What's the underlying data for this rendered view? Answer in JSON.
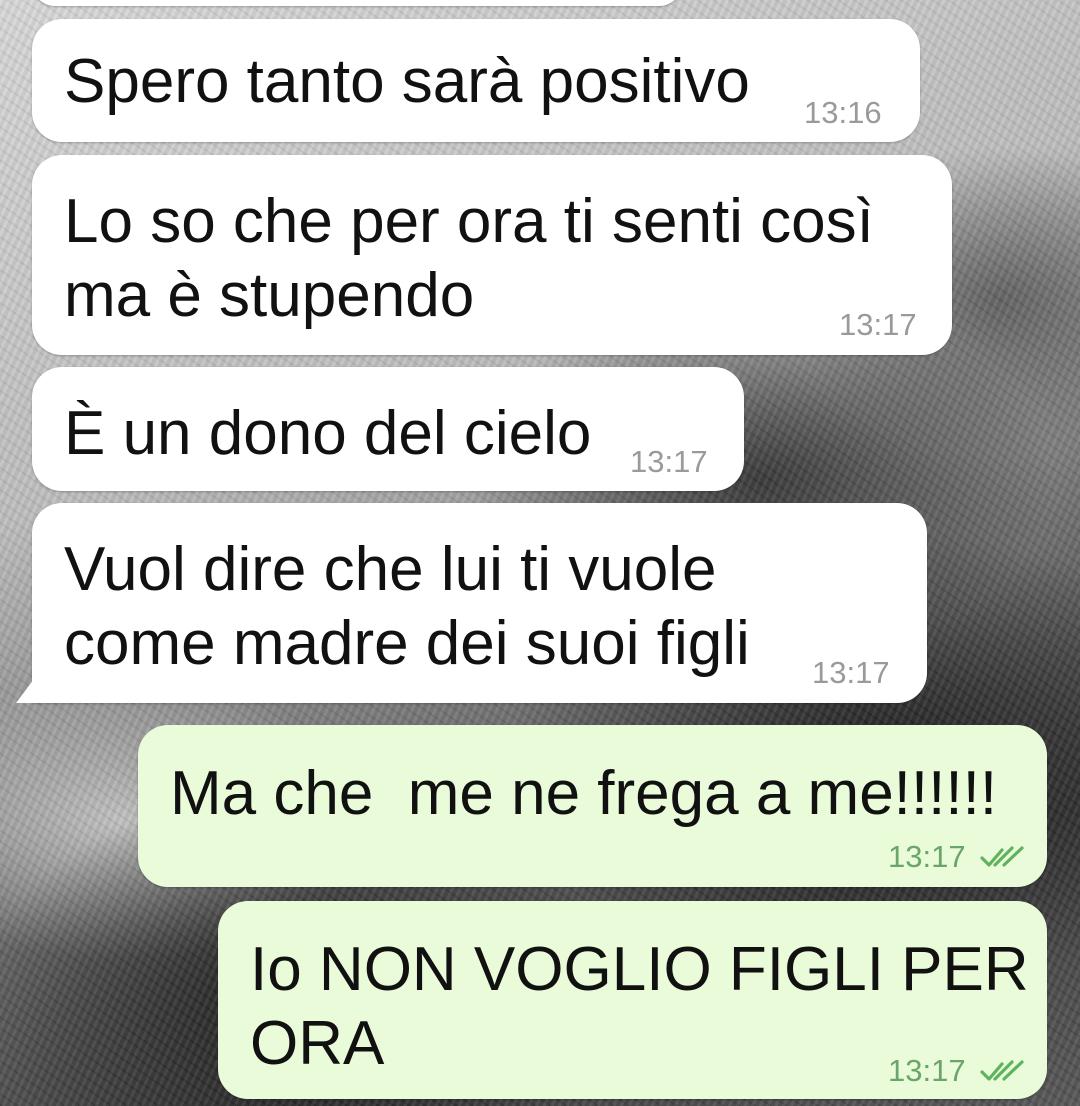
{
  "chat": {
    "messages": [
      {
        "id": "m1",
        "direction": "incoming",
        "text": "Spero tanto sarà positivo",
        "time": "13:16"
      },
      {
        "id": "m2",
        "direction": "incoming",
        "text": "Lo so che per ora ti senti così\nma è stupendo",
        "time": "13:17"
      },
      {
        "id": "m3",
        "direction": "incoming",
        "text": "È un dono del cielo",
        "time": "13:17"
      },
      {
        "id": "m4",
        "direction": "incoming",
        "text": "Vuol dire che lui ti vuole\ncome madre dei suoi figli",
        "time": "13:17"
      },
      {
        "id": "m5",
        "direction": "outgoing",
        "text": "Ma che  me ne frega a me!!!!!!",
        "time": "13:17",
        "status": "read"
      },
      {
        "id": "m6",
        "direction": "outgoing",
        "text": "Io NON VOGLIO FIGLI PER\nORA",
        "time": "13:17",
        "status": "read"
      }
    ]
  },
  "colors": {
    "incoming_bubble": "#ffffff",
    "outgoing_bubble": "#e9fbd9",
    "incoming_time": "#9a9a9a",
    "outgoing_time": "#6aa56a",
    "read_ticks": "#5fb35f"
  },
  "icons": {
    "read_receipt": "double-check-icon"
  }
}
